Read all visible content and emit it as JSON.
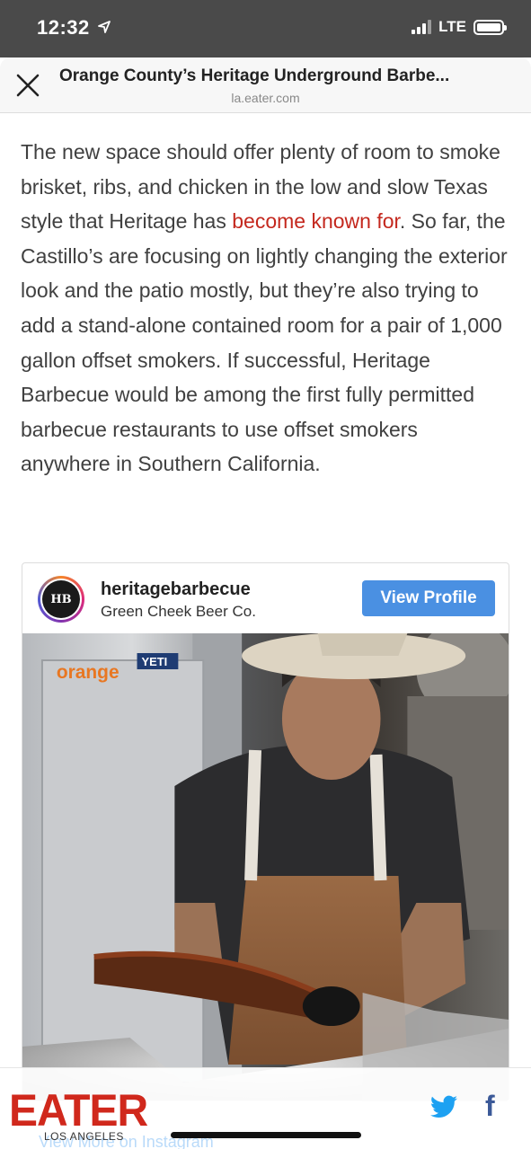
{
  "status_bar": {
    "time": "12:32",
    "network": "LTE",
    "location_icon": "location-arrow-icon",
    "signal_icon": "signal-bars-icon",
    "battery_icon": "battery-icon"
  },
  "browser": {
    "close_icon": "close-icon",
    "title": "Orange County’s Heritage Underground Barbe...",
    "url": "la.eater.com"
  },
  "article": {
    "text_before_link": "The new space should offer plenty of room to smoke brisket, ribs, and chicken in the low and slow Texas style that Heritage has ",
    "link_text": "become known for",
    "text_after_link": ". So far, the Castillo’s are focusing on lightly changing the exterior look and the patio mostly, but they’re also trying to add a stand-alone contained room for a pair of 1,000 gallon offset smokers. If successful, Heritage Barbecue would be among the first fully permitted barbecue restaurants to use offset smokers anywhere in Southern California.",
    "link_color": "#c4281e"
  },
  "instagram_embed": {
    "username": "heritagebarbecue",
    "location": "Green Cheek Beer Co.",
    "view_profile_label": "View Profile",
    "avatar_monogram": "HB",
    "photo_sign_orange": "orange",
    "photo_sign_yeti": "YETI",
    "view_more_label": "View More on Instagram",
    "button_color": "#4a90e2"
  },
  "footer": {
    "brand": "EATER",
    "city": "LOS ANGELES",
    "brand_color": "#d0281c",
    "twitter_icon": "twitter-icon",
    "facebook_icon": "facebook-icon",
    "facebook_glyph": "f"
  }
}
